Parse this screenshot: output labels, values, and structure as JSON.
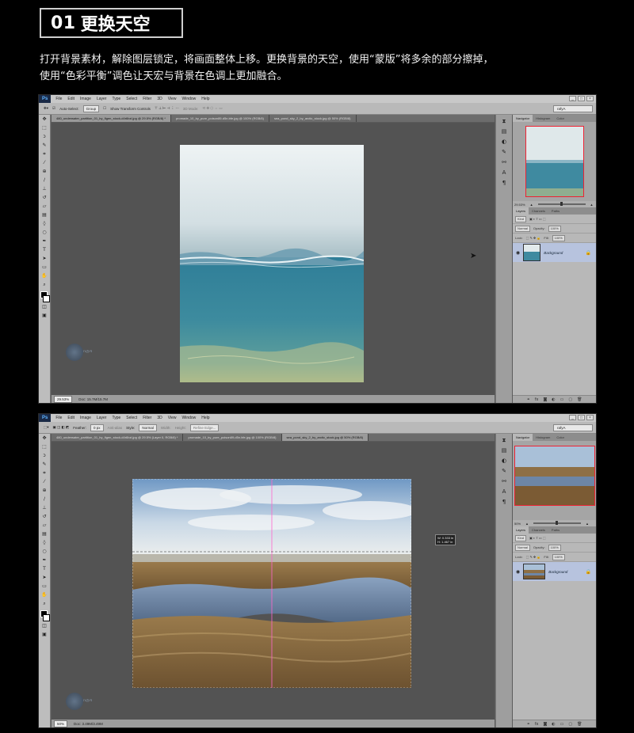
{
  "heading": {
    "number": "01",
    "text": "更换天空"
  },
  "description": {
    "line1": "打开背景素材，解除图层锁定，将画面整体上移。更换背景的天空，使用“蒙版”将多余的部分擦掉，",
    "line2": "使用“色彩平衡”调色让天宏与背景在色调上更加融合。"
  },
  "screenshot1": {
    "logo": "Ps",
    "menu": [
      "File",
      "Edit",
      "Image",
      "Layer",
      "Type",
      "Select",
      "Filter",
      "3D",
      "View",
      "Window",
      "Help"
    ],
    "options": {
      "auto_select": "Auto-Select:",
      "auto_select_value": "Group",
      "transform": "Show Transform Controls",
      "mode3d": "3D Mode:"
    },
    "workspace": "rafyA",
    "tabs": [
      "480_underwater_partition_01_by_figen_stock-d4r6bzl.jpg @ 29.5% (RGB/8) *",
      "promade_10_by_pure_poison89-d5n.bfe.jpg @ 100% (RGB/8)",
      "sea_pond_sky_2_by_arctic_stock.jpg @ 50% (RGB/8)"
    ],
    "active_tab": 0,
    "zoom": "29.53%",
    "doc_size": "Doc: 15.7M/15.7M",
    "panel_tabs": [
      "Navigator",
      "Histogram",
      "Color"
    ],
    "nav_zoom": "29.53%",
    "layer_tabs": [
      "Layers",
      "Channels",
      "Paths"
    ],
    "layer_kind": "Kind",
    "blend": "Normal",
    "opacity_label": "Opacity:",
    "opacity_value": "100%",
    "lock_label": "Lock:",
    "fill_label": "Fill:",
    "fill_value": "100%",
    "layer_name": "Background",
    "watermark": "rafyA"
  },
  "screenshot2": {
    "logo": "Ps",
    "menu": [
      "File",
      "Edit",
      "Image",
      "Layer",
      "Type",
      "Select",
      "Filter",
      "3D",
      "View",
      "Window",
      "Help"
    ],
    "options": {
      "feather_label": "Feather:",
      "feather_value": "0 px",
      "antialias": "Anti-alias",
      "style_label": "Style:",
      "style_value": "Normal",
      "width_label": "Width:",
      "height_label": "Height:",
      "refine": "Refine Edge..."
    },
    "workspace": "rafyA",
    "tabs": [
      "480_underwater_partition_01_by_figen_stock-d4r6bzl.jpg @ 29.5% (Layer 0, RGB/8) *",
      "promade_10_by_pure_poison89-d5n.bfe.jpg @ 100% (RGB/8)",
      "sea_pond_sky_2_by_arctic_stock.jpg @ 50% (RGB/8)"
    ],
    "active_tab": 2,
    "zoom": "50%",
    "doc_size": "Doc: 3.49M/3.49M",
    "measure": "W: 0.333 in\nH: 1.467 in",
    "panel_tabs": [
      "Navigator",
      "Histogram",
      "Color"
    ],
    "nav_zoom": "50%",
    "layer_tabs": [
      "Layers",
      "Channels",
      "Paths"
    ],
    "layer_kind": "Kind",
    "blend": "Normal",
    "opacity_label": "Opacity:",
    "opacity_value": "100%",
    "lock_label": "Lock:",
    "fill_label": "Fill:",
    "fill_value": "100%",
    "layer_name": "Background",
    "watermark": "rafyA"
  },
  "colors": {
    "ps_bg": "#535353",
    "accent_red": "#e23b3b",
    "selected_layer": "#b7c3de"
  },
  "icons": [
    "move-icon",
    "marquee-icon",
    "lasso-icon",
    "quick-select-icon",
    "crop-icon",
    "eyedropper-icon",
    "healing-icon",
    "brush-icon",
    "stamp-icon",
    "history-brush-icon",
    "eraser-icon",
    "gradient-icon",
    "blur-icon",
    "dodge-icon",
    "pen-icon",
    "type-icon",
    "path-select-icon",
    "shape-icon",
    "hand-icon",
    "zoom-icon",
    "eye-icon",
    "lock-icon"
  ]
}
